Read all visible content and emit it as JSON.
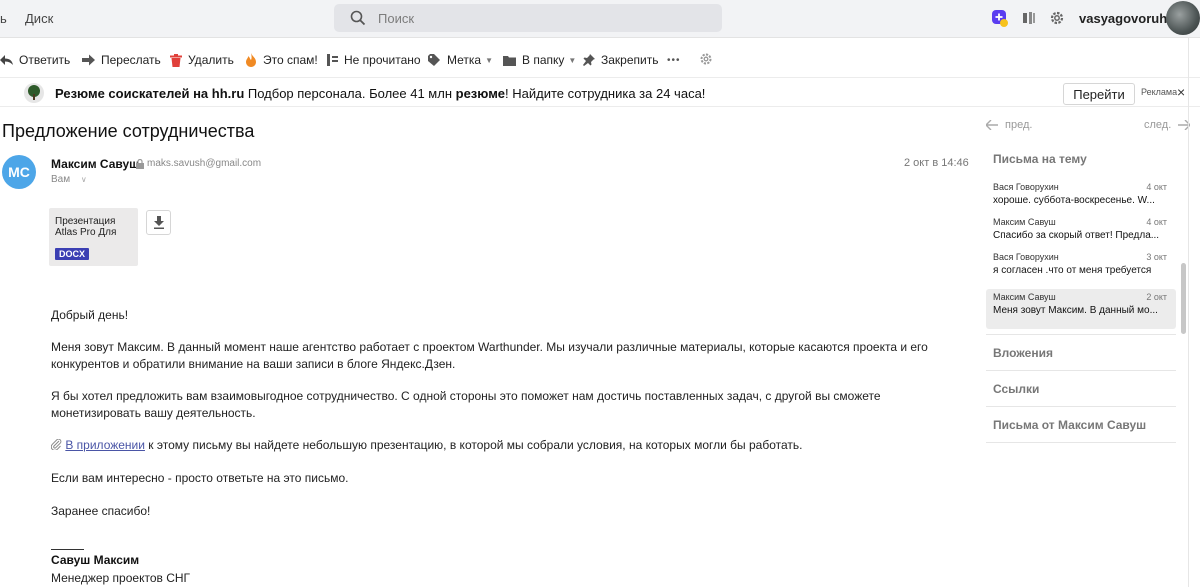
{
  "topbar": {
    "left_tab": "ь",
    "disk": "Диск",
    "search_placeholder": "Поиск",
    "username": "vasyagovoruhin"
  },
  "toolbar": {
    "reply": "Ответить",
    "forward": "Переслать",
    "delete": "Удалить",
    "spam": "Это спам!",
    "unread": "Не прочитано",
    "label": "Метка",
    "folder": "В папку",
    "pin": "Закрепить",
    "more": "•••"
  },
  "ad": {
    "bold1": "Резюме соискателей на hh.ru",
    "text1": " Подбор персонала. Более 41 млн ",
    "bold2": "резюме",
    "text2": "! Найдите сотрудника за 24 часа!",
    "go": "Перейти",
    "label": "Реклама",
    "close": "×"
  },
  "letter": {
    "subject": "Предложение сотрудничества",
    "avatar_initials": "MC",
    "sender_name": "Максим Савуш",
    "sender_email": "maks.savush@gmail.com",
    "recipient": "Вам",
    "date": "2 окт в 14:46",
    "attachment": {
      "name": "Презентация Atlas Pro Для",
      "type": "DOCX"
    },
    "greeting": "Добрый день!",
    "para1": "Меня зовут Максим. В данный момент наше агентство работает с проектом Warthunder. Мы изучали различные материалы, которые касаются проекта и его конкурентов и обратили внимание на ваши записи в блоге Яндекс.Дзен.",
    "para2": "Я бы хотел предложить вам взаимовыгодное сотрудничество. С одной стороны это поможет нам достичь поставленных задач, с другой вы сможете монетизировать вашу деятельность.",
    "para3_link": "В приложении",
    "para3_rest": " к этому письму вы найдете небольшую презентацию, в которой мы собрали условия, на которых могли бы работать.",
    "para4": "Если вам интересно - просто ответьте на это письмо.",
    "para5": "Заранее спасибо!",
    "sig_name": "Савуш Максим",
    "sig_role": "Менеджер проектов СНГ"
  },
  "panel": {
    "prev": "пред.",
    "next": "след.",
    "related_title": "Письма на тему",
    "threads": [
      {
        "from": "Вася Говорухин",
        "date": "4 окт",
        "snippet": "хороше. суббота-воскресенье. W..."
      },
      {
        "from": "Максим Савуш",
        "date": "4 окт",
        "snippet": "Спасибо за скорый ответ! Предла..."
      },
      {
        "from": "Вася Говорухин",
        "date": "3 окт",
        "snippet": "я согласен .что от меня требуется"
      },
      {
        "from": "Максим Савуш",
        "date": "2 окт",
        "snippet": "Меня зовут Максим. В данный мо..."
      }
    ],
    "attachments": "Вложения",
    "links": "Ссылки",
    "from_sender": "Письма от Максим Савуш"
  },
  "colors": {
    "avatar": "#4da6e8",
    "docx_badge": "#3b3fb3",
    "link": "#4a55a6",
    "delete": "#e0403a",
    "spam": "#f08a24"
  }
}
